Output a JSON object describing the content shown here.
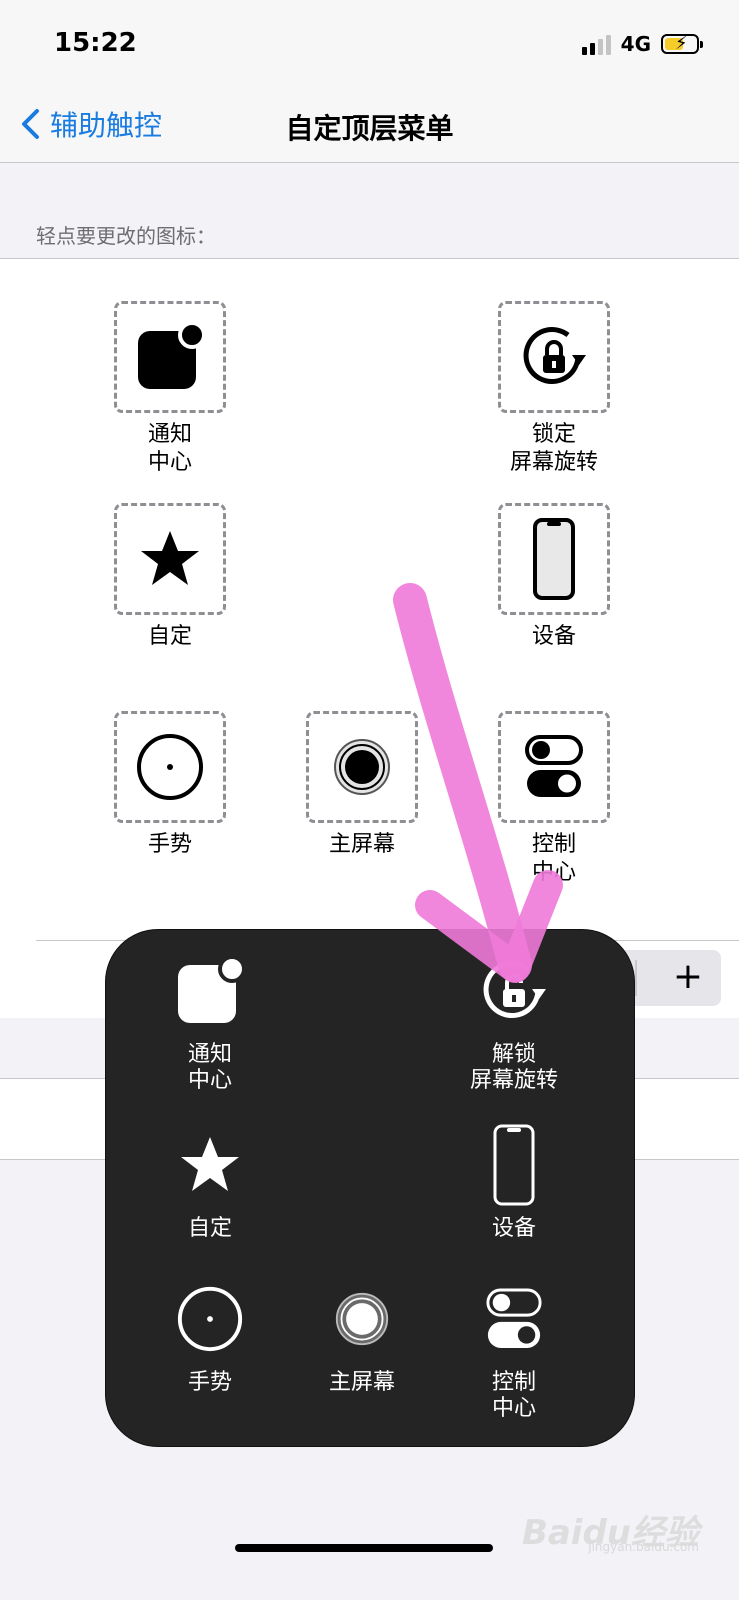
{
  "status": {
    "time": "15:22",
    "network": "4G",
    "battery_color": "#f5cc2a"
  },
  "nav": {
    "back_label": "辅助触控",
    "title": "自定顶层菜单"
  },
  "section_header": "轻点要更改的图标：",
  "grid_items": [
    {
      "id": "notification-center",
      "label": "通知\n中心",
      "icon": "notification-icon"
    },
    {
      "id": "lock-rotation",
      "label": "锁定\n屏幕旋转",
      "icon": "rotation-lock-icon"
    },
    {
      "id": "custom",
      "label": "自定",
      "icon": "star-icon"
    },
    {
      "id": "device",
      "label": "设备",
      "icon": "phone-device-icon"
    },
    {
      "id": "gesture",
      "label": "手势",
      "icon": "gesture-circle-icon"
    },
    {
      "id": "home-screen",
      "label": "主屏幕",
      "icon": "home-button-icon"
    },
    {
      "id": "control-center",
      "label": "控制\n中心",
      "icon": "toggle-switches-icon"
    }
  ],
  "stepper": {
    "plus": "+"
  },
  "overlay_menu": [
    {
      "id": "notification-center",
      "label": "通知\n中心",
      "icon": "notification-icon"
    },
    {
      "id": "unlock-rotation",
      "label": "解锁\n屏幕旋转",
      "icon": "rotation-unlock-icon"
    },
    {
      "id": "custom",
      "label": "自定",
      "icon": "star-icon"
    },
    {
      "id": "device",
      "label": "设备",
      "icon": "phone-device-icon"
    },
    {
      "id": "gesture",
      "label": "手势",
      "icon": "gesture-circle-icon"
    },
    {
      "id": "home-screen",
      "label": "主屏幕",
      "icon": "home-button-icon"
    },
    {
      "id": "control-center",
      "label": "控制\n中心",
      "icon": "toggle-switches-icon"
    }
  ],
  "annotation": {
    "arrow_color": "#f07ad8"
  },
  "watermark": {
    "brand": "Baidu经验",
    "url": "jingyan.baidu.com"
  }
}
